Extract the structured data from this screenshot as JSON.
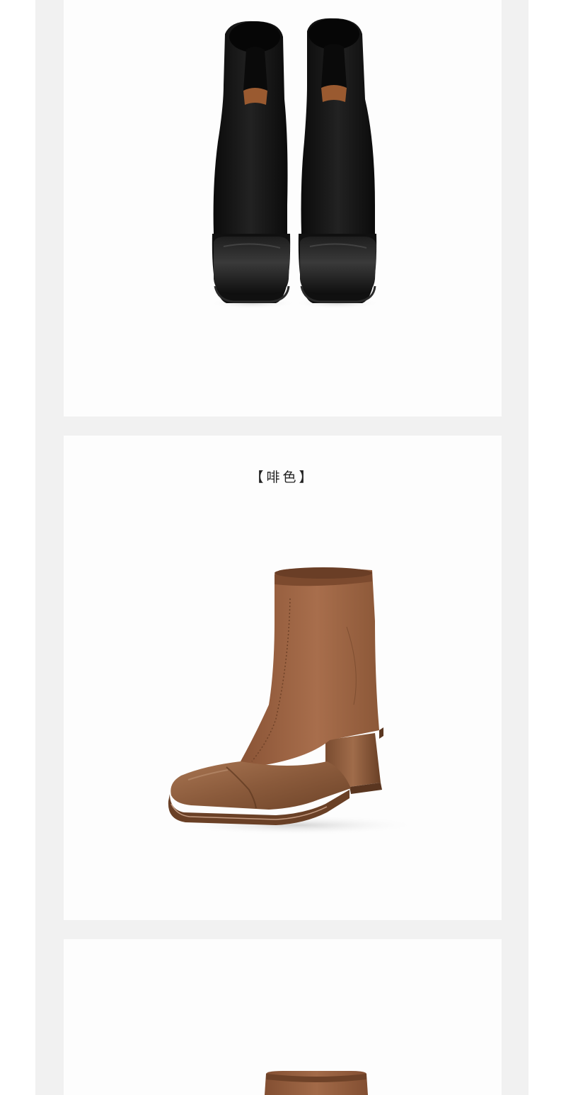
{
  "colors": {
    "background": "#ffffff",
    "frame": "#f1f1f1",
    "panel": "#fdfdfd",
    "boot_black": "#141414",
    "boot_brown": "#9b6444",
    "toe_brown": "#8a5a3b"
  },
  "panels": [
    {
      "image": "black-ankle-boots-pair-front"
    },
    {
      "caption": "【啡色】",
      "image": "brown-ankle-boot-side"
    },
    {
      "image": "brown-boot-cropped"
    }
  ]
}
